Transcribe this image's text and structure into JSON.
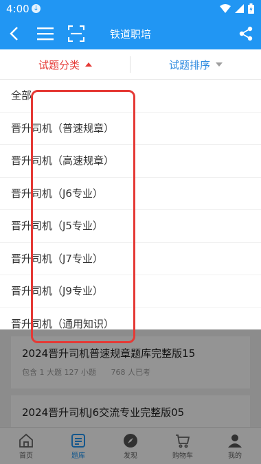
{
  "status": {
    "time": "4:00",
    "download_badge": "↓"
  },
  "app_bar": {
    "title": "铁道职培"
  },
  "sort_tabs": {
    "category": "试题分类",
    "order": "试题排序"
  },
  "categories": [
    "全部",
    "晋升司机（普速规章）",
    "晋升司机（高速规章）",
    "晋升司机（J6专业）",
    "晋升司机（J5专业）",
    "晋升司机（J7专业）",
    "晋升司机（J9专业）",
    "晋升司机（通用知识）"
  ],
  "results": [
    {
      "title": "2024晋升司机普速规章题库完整版15",
      "meta_left": "包含 1 大题 127 小题",
      "meta_right": "768 人已考"
    },
    {
      "title": "2024晋升司机J6交流专业完整版05"
    }
  ],
  "bottom_nav": [
    {
      "label": "首页",
      "icon": "home-icon"
    },
    {
      "label": "题库",
      "icon": "question-bank-icon"
    },
    {
      "label": "发现",
      "icon": "compass-icon"
    },
    {
      "label": "购物车",
      "icon": "cart-icon"
    },
    {
      "label": "我的",
      "icon": "profile-icon"
    }
  ],
  "colors": {
    "primary": "#2196f3",
    "active_tab": "#e53935",
    "inactive_tab": "#2e8be0",
    "highlight_box": "#e53935"
  }
}
